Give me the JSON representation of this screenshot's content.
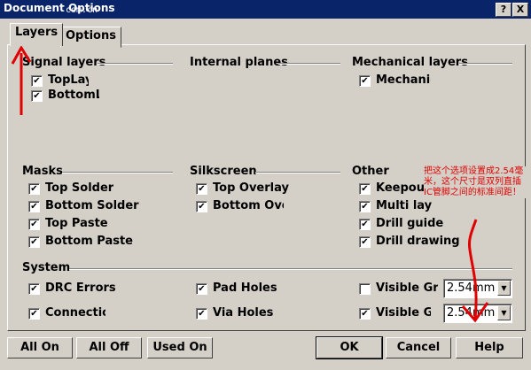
{
  "window": {
    "title": "Document Options",
    "watermark": "com.cn"
  },
  "titlebar_buttons": [
    "?",
    "X"
  ],
  "tabs": [
    {
      "label": "Layers"
    },
    {
      "label": "Options"
    }
  ],
  "groups": {
    "signal": {
      "label": "Signal layers",
      "items": [
        {
          "label": "TopLay",
          "checked": true
        },
        {
          "label": "BottomLa",
          "checked": true
        }
      ]
    },
    "internal": {
      "label": "Internal planes"
    },
    "mechanical": {
      "label": "Mechanical layers",
      "items": [
        {
          "label": "Mechanic",
          "checked": true
        }
      ]
    },
    "masks": {
      "label": "Masks",
      "items": [
        {
          "label": "Top Solder",
          "checked": true
        },
        {
          "label": "Bottom Solder",
          "checked": true
        },
        {
          "label": "Top Paste",
          "checked": true
        },
        {
          "label": "Bottom Paste",
          "checked": true
        }
      ]
    },
    "silkscreen": {
      "label": "Silkscreen",
      "items": [
        {
          "label": "Top Overlay",
          "checked": true
        },
        {
          "label": "Bottom Over",
          "checked": true
        }
      ]
    },
    "other": {
      "label": "Other",
      "items": [
        {
          "label": "Keepout",
          "checked": true
        },
        {
          "label": "Multi lay",
          "checked": true
        },
        {
          "label": "Drill guide",
          "checked": true
        },
        {
          "label": "Drill drawing",
          "checked": true
        }
      ]
    },
    "system": {
      "label": "System",
      "items": [
        {
          "label": "DRC Errors",
          "checked": true
        },
        {
          "label": "Connection",
          "checked": true
        },
        {
          "label": "Pad Holes",
          "checked": true
        },
        {
          "label": "Via Holes",
          "checked": true
        },
        {
          "label": "Visible Gri",
          "checked": false
        },
        {
          "label": "Visible Gr",
          "checked": true
        }
      ]
    }
  },
  "grid_values": [
    "2.54mm",
    "2.54mm"
  ],
  "annotation": "把这个选项设置成2.54毫米，这个尺寸是双列直插IC管脚之间的标准间距！",
  "buttons": {
    "all_on": "All On",
    "all_off": "All Off",
    "used_on": "Used On",
    "ok": "OK",
    "cancel": "Cancel",
    "help": "Help"
  },
  "colors": {
    "titlebar": "#0a246a",
    "face": "#d4d0c8",
    "annotation": "#e00000"
  }
}
